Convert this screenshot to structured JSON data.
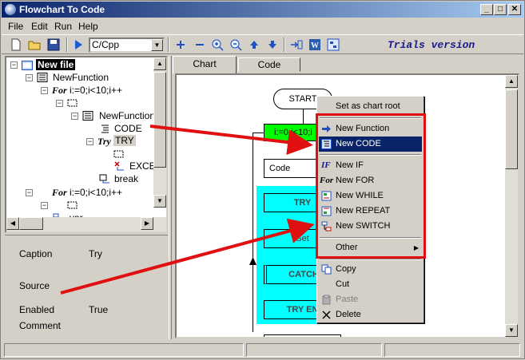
{
  "window": {
    "title": "Flowchart To Code"
  },
  "menu": {
    "items": [
      "File",
      "Edit",
      "Run",
      "Help"
    ]
  },
  "toolbar": {
    "language": "C/Cpp",
    "trials": "Trials version",
    "icons": [
      "new-file-icon",
      "open-folder-icon",
      "save-icon",
      "run-icon",
      "add-icon",
      "remove-icon",
      "zoom-in-icon",
      "zoom-out-icon",
      "move-up-icon",
      "move-down-icon",
      "insert-icon",
      "word-icon",
      "export-icon"
    ]
  },
  "tree": {
    "root": "New file",
    "items": [
      {
        "prefix": "",
        "label": "NewFunction"
      },
      {
        "prefix": "For",
        "label": "i:=0;i<10;i++"
      },
      {
        "prefix": "",
        "label": "NewFunction"
      },
      {
        "prefix": "",
        "label": "CODE"
      },
      {
        "prefix": "Try",
        "label": "TRY"
      },
      {
        "prefix": "",
        "label": "EXCEP"
      },
      {
        "prefix": "",
        "label": "break"
      },
      {
        "prefix": "For",
        "label": "i:=0;i<10;i++"
      },
      {
        "prefix": "",
        "label": "var"
      }
    ]
  },
  "properties": {
    "caption_label": "Caption",
    "caption_value": "Try",
    "source_label": "Source",
    "enabled_label": "Enabled",
    "enabled_value": "True",
    "comment_label": "Comment"
  },
  "tabs": [
    {
      "label": "Chart"
    },
    {
      "label": "Code"
    }
  ],
  "flowchart": {
    "start": "START",
    "for_label": "i:=0;i<10;i",
    "code": "Code",
    "try": "TRY",
    "set": "Set",
    "catch": "CATCH",
    "try_end": "TRY EN"
  },
  "context_menu": {
    "items": [
      {
        "label": "Set as chart root",
        "icon": ""
      },
      {
        "label": "New Function",
        "icon": "arrow-icon"
      },
      {
        "label": "New CODE",
        "icon": "code-icon",
        "highlighted": true
      },
      {
        "label": "New IF",
        "icon": "if-icon"
      },
      {
        "label": "New FOR",
        "icon": "for-icon"
      },
      {
        "label": "New WHILE",
        "icon": "while-icon"
      },
      {
        "label": "New REPEAT",
        "icon": "repeat-icon"
      },
      {
        "label": "New SWITCH",
        "icon": "switch-icon"
      },
      {
        "label": "Other",
        "icon": "",
        "submenu": true
      },
      {
        "label": "Copy",
        "icon": "copy-icon"
      },
      {
        "label": "Cut",
        "icon": ""
      },
      {
        "label": "Paste",
        "icon": "paste-icon",
        "disabled": true
      },
      {
        "label": "Delete",
        "icon": "delete-icon"
      }
    ]
  },
  "icon_text": {
    "if": "IF",
    "for": "For",
    "try": "Try"
  },
  "colors": {
    "accent": "#0a246a",
    "annotation": "#e01010",
    "try_block": "#00ffff",
    "for_block": "#00ff00"
  }
}
